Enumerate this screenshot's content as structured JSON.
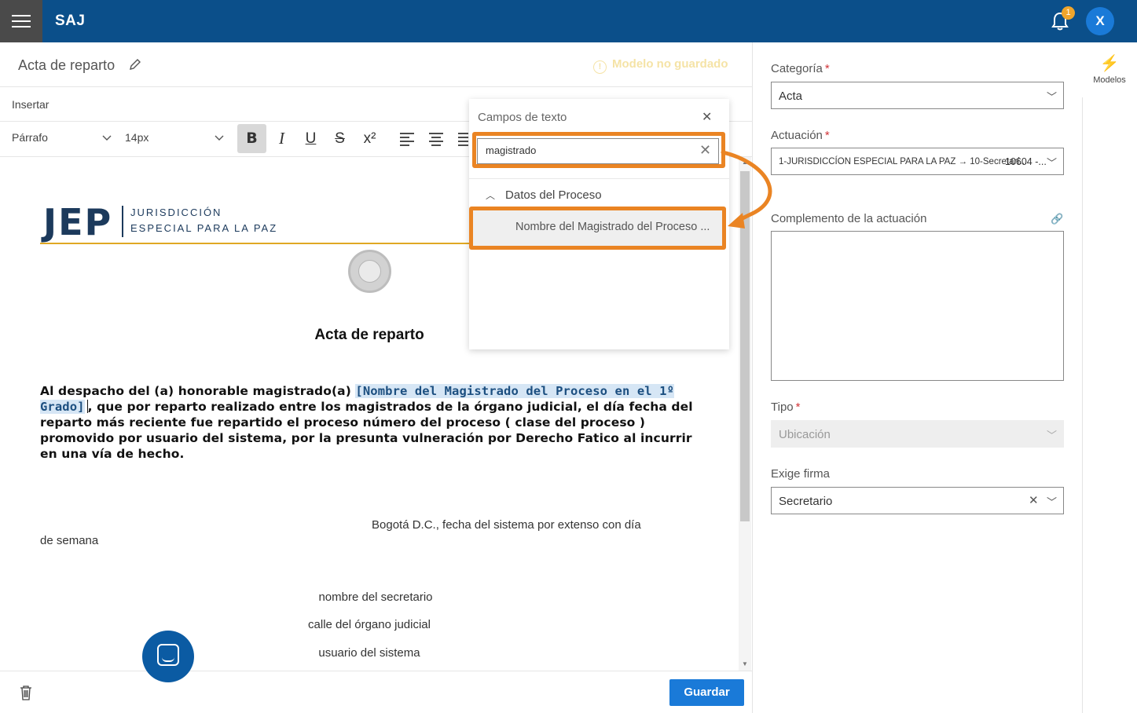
{
  "app": {
    "title": "SAJ",
    "notifications_count": "1",
    "user_initial": "X"
  },
  "document": {
    "title": "Acta de reparto",
    "status": "Modelo no guardado",
    "insert_label": "Insertar"
  },
  "toolbar": {
    "paragraph_style": "Párrafo",
    "font_size": "14px",
    "bold": "B",
    "italic": "I",
    "underline": "U",
    "strike": "S",
    "superscript": "x²"
  },
  "doc_content": {
    "logo_letters": "JEP",
    "logo_line1": "JURISDICCIÓN",
    "logo_line2": "ESPECIAL PARA LA PAZ",
    "heading": "Acta de reparto",
    "paragraph_start": "Al despacho del (a) honorable magistrado(a) ",
    "paragraph_field": "[Nombre del Magistrado del Proceso en el 1º Grado]",
    "paragraph_rest": ", que por reparto realizado entre los magistrados de la órgano judicial, el día fecha del reparto más reciente fue repartido el proceso número del proceso ( clase del proceso ) promovido por usuario del sistema, por la presunta vulneración por Derecho Fatico al incurrir en una vía de hecho.",
    "city_line": "Bogotá D.C., fecha del sistema por extenso con día",
    "weekday": "de semana",
    "secretary": "nombre del secretario",
    "court_address": "calle del órgano judicial",
    "system_user": "usuario del sistema"
  },
  "footer": {
    "save_label": "Guardar"
  },
  "text_fields_popup": {
    "title": "Campos de texto",
    "search_value": "magistrado",
    "group_label": "Datos del Proceso",
    "item_label": "Nombre del Magistrado del Proceso ..."
  },
  "right_panel": {
    "models_label": "Modelos",
    "category_label": "Categoría",
    "category_value": "Acta",
    "actuation_label": "Actuación",
    "actuation_value": "1-JURISDICCÍON ESPECIAL PARA LA PAZ → 10-Secretarí...",
    "actuation_code": "10604 -...",
    "complement_label": "Complemento de la actuación",
    "type_label": "Tipo",
    "type_value": "Ubicación",
    "signature_label": "Exige firma",
    "signature_value": "Secretario",
    "required_mark": "*"
  },
  "colors": {
    "topbar": "#0b4f8a",
    "accent": "#1a7ad8",
    "highlight_orange": "#ea8423",
    "unsaved_warning": "#f5e3a6",
    "required": "#d13438"
  }
}
